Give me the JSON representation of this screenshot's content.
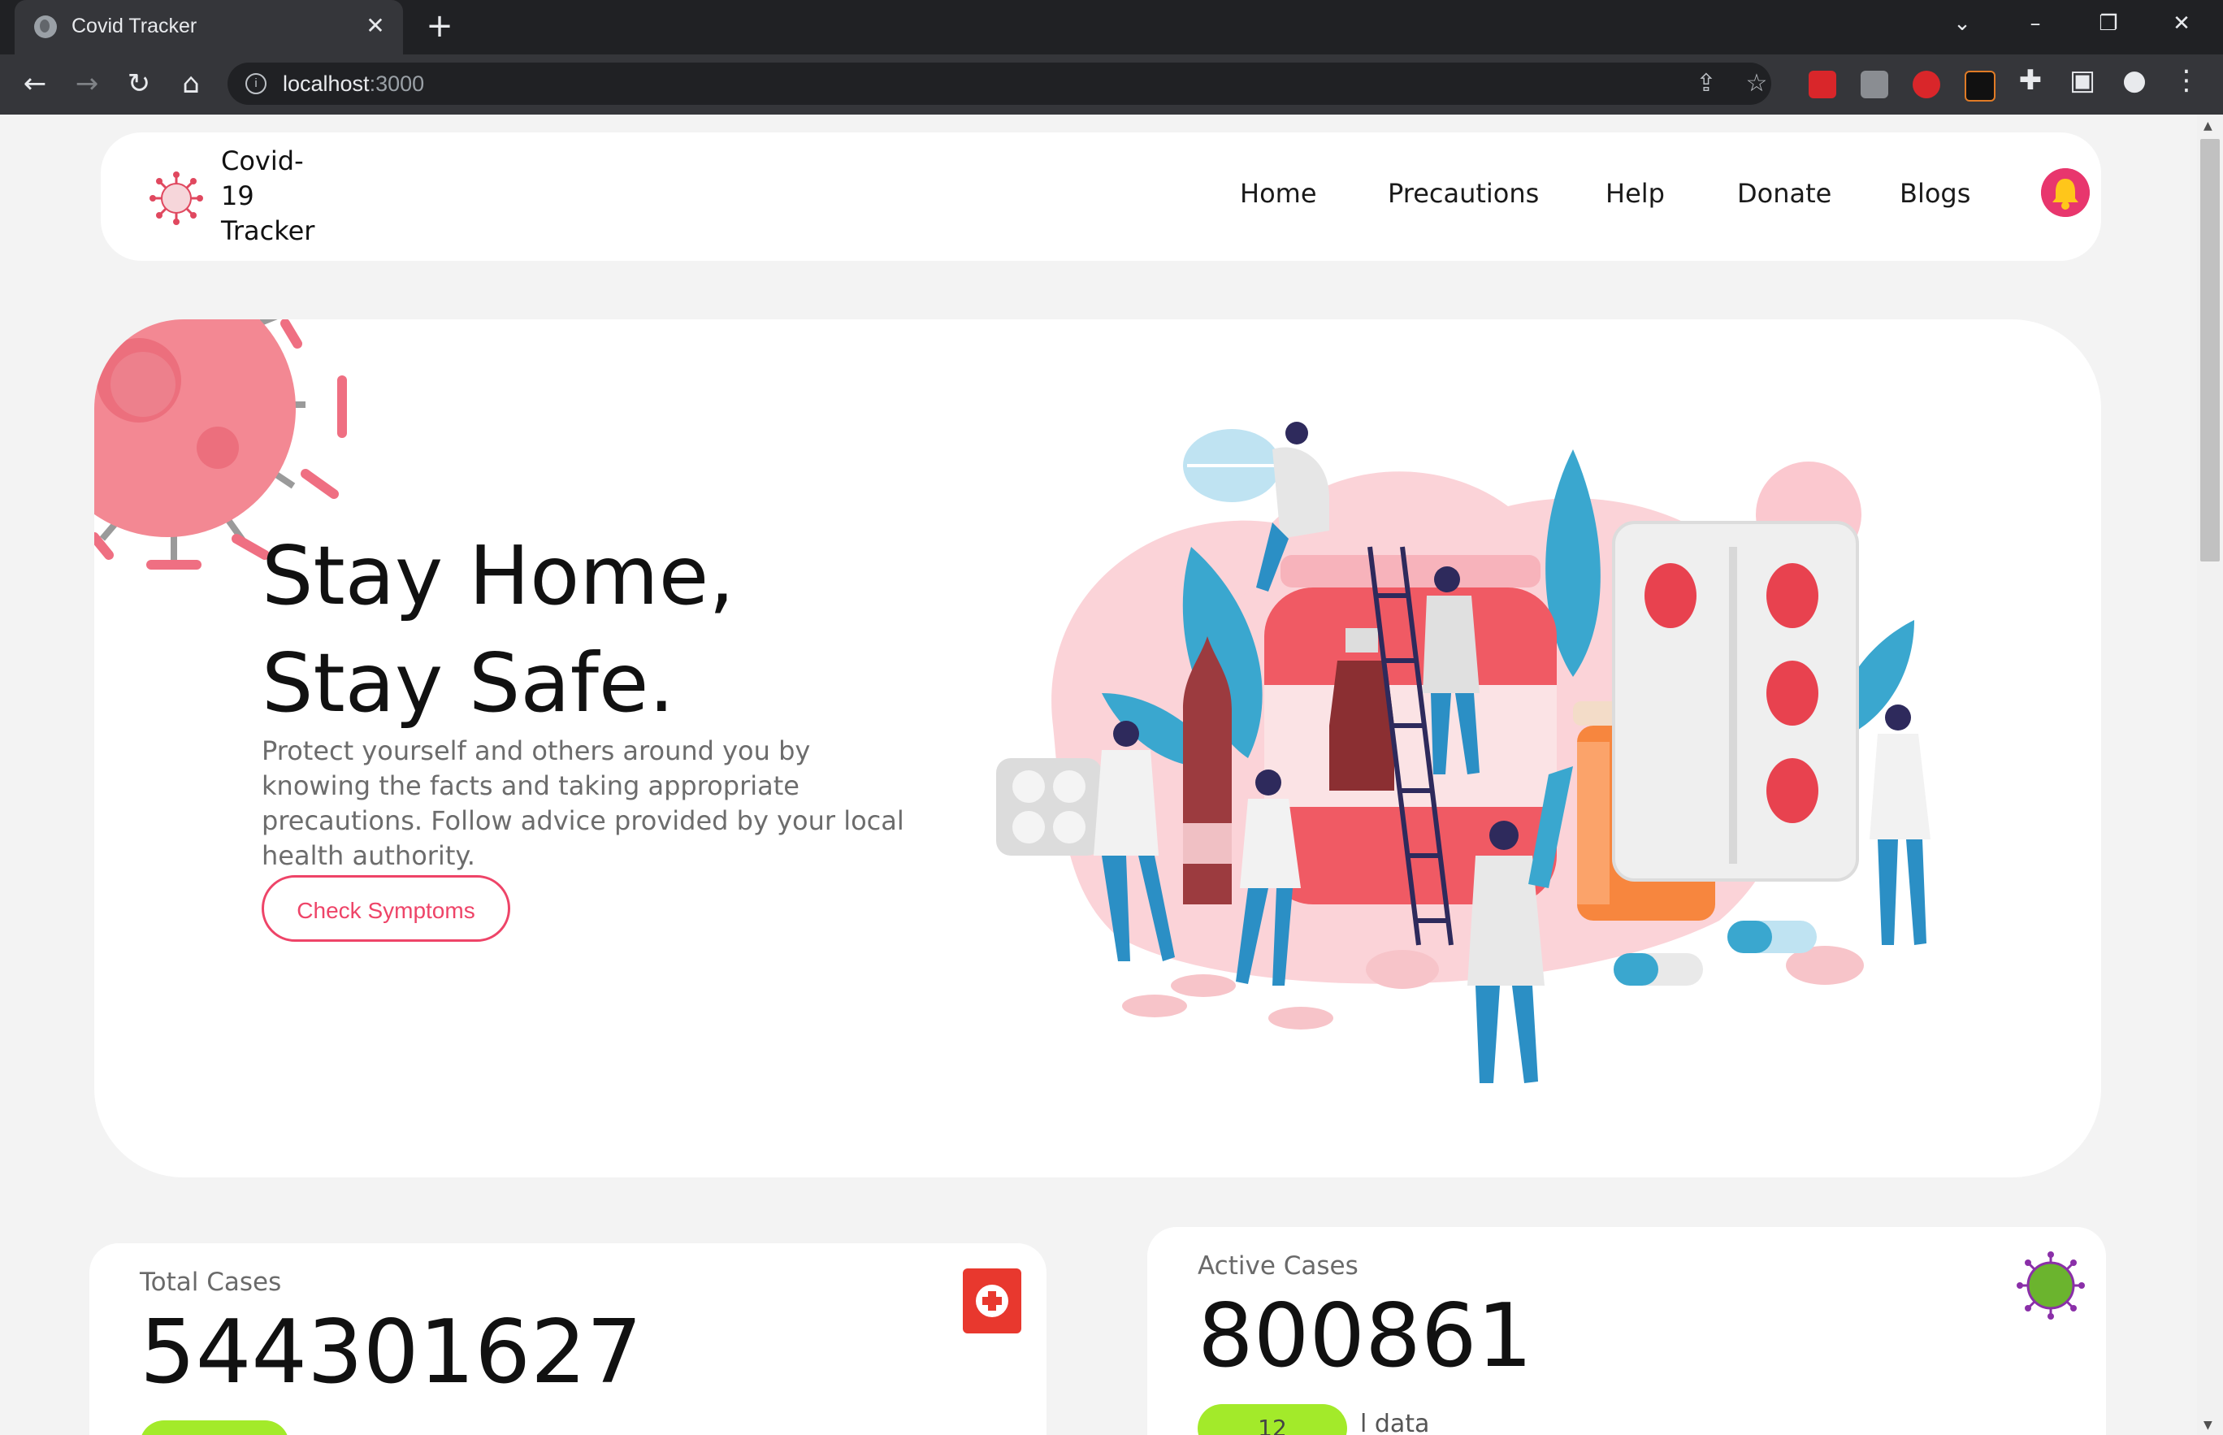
{
  "browser": {
    "tab_title": "Covid Tracker",
    "url_host": "localhost",
    "url_port": ":3000"
  },
  "header": {
    "logo_line1": "Covid-",
    "logo_line2": "19",
    "logo_line3": "Tracker",
    "nav": [
      "Home",
      "Precautions",
      "Help",
      "Donate",
      "Blogs"
    ]
  },
  "hero": {
    "title_line1": "Stay Home,",
    "title_line2": "Stay Safe.",
    "description": "Protect yourself and others around you by knowing the facts and taking appropriate precautions. Follow advice provided by your local health authority.",
    "button": "Check Symptoms"
  },
  "stats": {
    "total_label": "Total Cases",
    "total_value": "544301627",
    "active_label": "Active Cases",
    "active_value": "800861",
    "active_pill": "12",
    "active_pill_suffix": "l data"
  },
  "colors": {
    "accent": "#ee4468",
    "pill": "#a3ea2a",
    "virus": "#f27d8a"
  }
}
